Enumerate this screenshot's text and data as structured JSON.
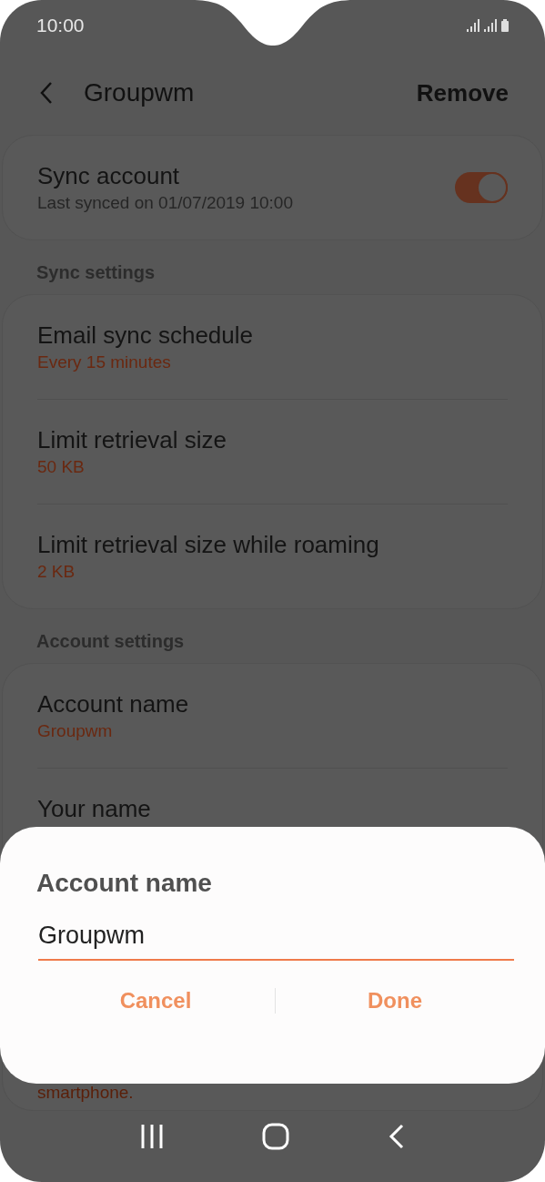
{
  "status_bar": {
    "time": "10:00"
  },
  "header": {
    "title": "Groupwm",
    "action": "Remove"
  },
  "sync_account": {
    "title": "Sync account",
    "subtitle": "Last synced on 01/07/2019  10:00",
    "on": true
  },
  "sections": [
    {
      "heading": "Sync settings",
      "items": [
        {
          "title": "Email sync schedule",
          "value": "Every 15 minutes"
        },
        {
          "title": "Limit retrieval size",
          "value": "50 KB"
        },
        {
          "title": "Limit retrieval size while roaming",
          "value": "2 KB"
        }
      ]
    },
    {
      "heading": "Account settings",
      "items": [
        {
          "title": "Account name",
          "value": "Groupwm"
        },
        {
          "title": "Your name",
          "note": "smartphone."
        }
      ]
    }
  ],
  "dialog": {
    "title": "Account name",
    "value": "Groupwm",
    "buttons": [
      "Cancel",
      "Done"
    ]
  }
}
